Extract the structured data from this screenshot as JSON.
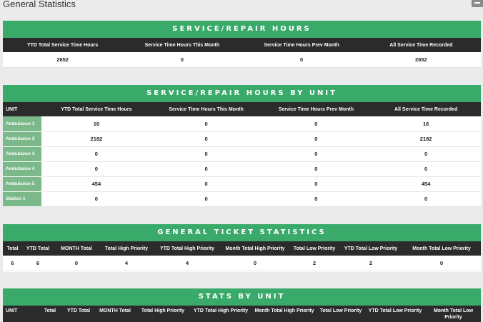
{
  "page": {
    "title": "General Statistics"
  },
  "service_hours": {
    "banner": "SERVICE/REPAIR HOURS",
    "headers": [
      "YTD Total Service Time Hours",
      "Service Time Hours This Month",
      "Service Time Hours Prev Month",
      "All Service Time Recorded"
    ],
    "values": [
      "2652",
      "0",
      "0",
      "2652"
    ]
  },
  "hours_by_unit": {
    "banner": "SERVICE/REPAIR HOURS BY UNIT",
    "headers": [
      "UNIT",
      "YTD Total Service Time Hours",
      "Service Time Hours This Month",
      "Service Time Hours Prev Month",
      "All Service Time Recorded"
    ],
    "rows": [
      [
        "Ambulance 1",
        "16",
        "0",
        "0",
        "16"
      ],
      [
        "Ambulance 2",
        "2182",
        "0",
        "0",
        "2182"
      ],
      [
        "Ambulance 3",
        "0",
        "0",
        "0",
        "0"
      ],
      [
        "Ambulance 4",
        "0",
        "0",
        "0",
        "0"
      ],
      [
        "Ambulance 5",
        "454",
        "0",
        "0",
        "454"
      ],
      [
        "Station 1",
        "0",
        "0",
        "0",
        "0"
      ]
    ]
  },
  "ticket_stats": {
    "banner": "GENERAL TICKET STATISTICS",
    "headers": [
      "Total",
      "YTD Total",
      "MONTH Total",
      "Total High Priority",
      "YTD Total High Priority",
      "Month Total High Priority",
      "Total Low Priority",
      "YTD Total Low Priority",
      "Month Total Low Priority"
    ],
    "values": [
      "6",
      "6",
      "0",
      "4",
      "4",
      "0",
      "2",
      "2",
      "0"
    ]
  },
  "stats_by_unit": {
    "banner": "STATS BY UNIT",
    "headers": [
      "UNIT",
      "Total",
      "YTD Total",
      "MONTH Total",
      "Total High Priority",
      "YTD Total High Priority",
      "Month Total High Priority",
      "Total Low Priority",
      "YTD Total Low Priority",
      "Month Total Low Priority"
    ]
  }
}
